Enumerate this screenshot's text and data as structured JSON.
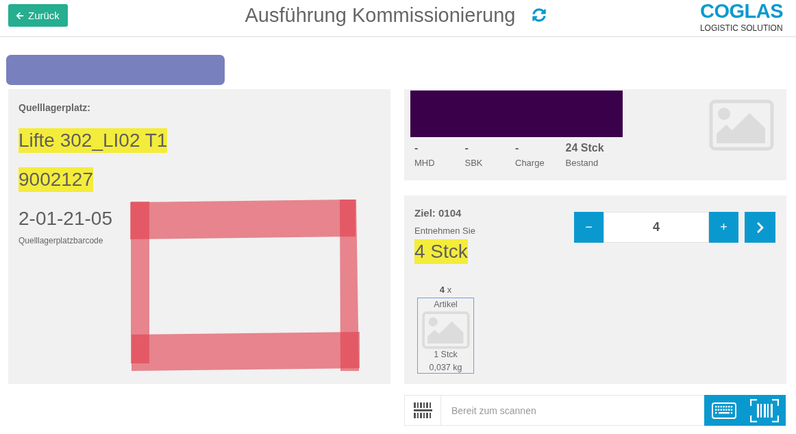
{
  "header": {
    "back_button": {
      "label": "Zurück"
    },
    "title": "Ausführung Kommissionierung",
    "logo": {
      "name": "COGLAS",
      "tagline": "LOGISTIC SOLUTION"
    }
  },
  "source_location": {
    "heading": "Quelllagerplatz:",
    "lines": [
      {
        "text": "Lifte 302_LI02 T1",
        "highlighted": true
      },
      {
        "text": "9002127",
        "highlighted": true
      },
      {
        "text": "2-01-21-05",
        "highlighted": false
      }
    ],
    "caption": "Quelllagerplatzbarcode"
  },
  "article": {
    "details": [
      {
        "value": "-",
        "label": "MHD"
      },
      {
        "value": "-",
        "label": "SBK"
      },
      {
        "value": "-",
        "label": "Charge"
      },
      {
        "value": "24 Stck",
        "label": "Bestand"
      }
    ]
  },
  "pick": {
    "target": "Ziel: 0104",
    "instruction": "Entnehmen Sie",
    "quantity": {
      "text": "4 Stck",
      "highlighted": true
    },
    "stepper": {
      "decrement": "−",
      "value": "4",
      "increment": "+"
    },
    "package": {
      "count": "**4** x",
      "name": "Artikel",
      "units": "1 Stck",
      "weight": "0,037 kg"
    }
  },
  "scanner": {
    "placeholder": "Bereit zum scannen"
  }
}
